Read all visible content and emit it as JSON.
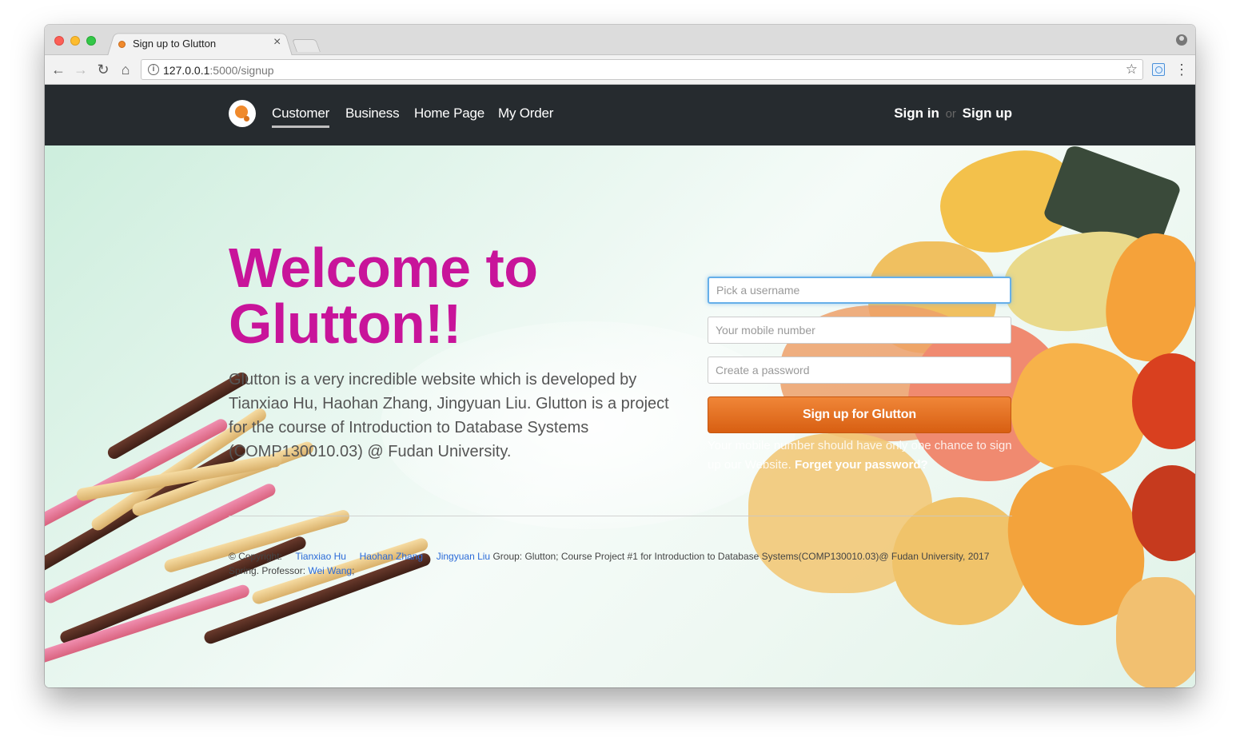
{
  "browser": {
    "tab_title": "Sign up to Glutton",
    "tab_close": "×",
    "url_host": "127.0.0.1",
    "url_path": ":5000/signup",
    "star": "☆",
    "menu": "⋮",
    "back": "←",
    "forward": "→",
    "reload": "↻",
    "home": "⌂"
  },
  "navbar": {
    "links": [
      "Customer",
      "Business",
      "Home Page",
      "My Order"
    ],
    "active": "Customer",
    "sign_in": "Sign in",
    "or": "or",
    "sign_up": "Sign up"
  },
  "hero": {
    "title_line1": "Welcome to",
    "title_line2": "Glutton!!",
    "description": "Glutton is a very incredible website which is developed by Tianxiao Hu, Haohan Zhang, Jingyuan Liu. Glutton is a project for the course of Introduction to Database Systems (COMP130010.03) @ Fudan University."
  },
  "form": {
    "username_placeholder": "Pick a username",
    "mobile_placeholder": "Your mobile number",
    "password_placeholder": "Create a password",
    "submit_label": "Sign up for Glutton",
    "note_text": "Your mobile number should have only one chance to sign up our Website.",
    "forgot_link": "Forget your password?"
  },
  "footer": {
    "copyright": "© Copyright:",
    "authors": [
      "Tianxiao Hu",
      "Haohan Zhang",
      "Jingyuan Liu"
    ],
    "group_text": "Group: Glutton; Course Project #1 for Introduction to Database Systems(COMP130010.03)@ Fudan University, 2017 Spring. Professor:",
    "professor": "Wei Wang",
    "end": ";"
  },
  "colors": {
    "title": "#c8149a",
    "navbar_bg": "#262b2f",
    "button": "#e87424",
    "link": "#2a6ad8"
  }
}
